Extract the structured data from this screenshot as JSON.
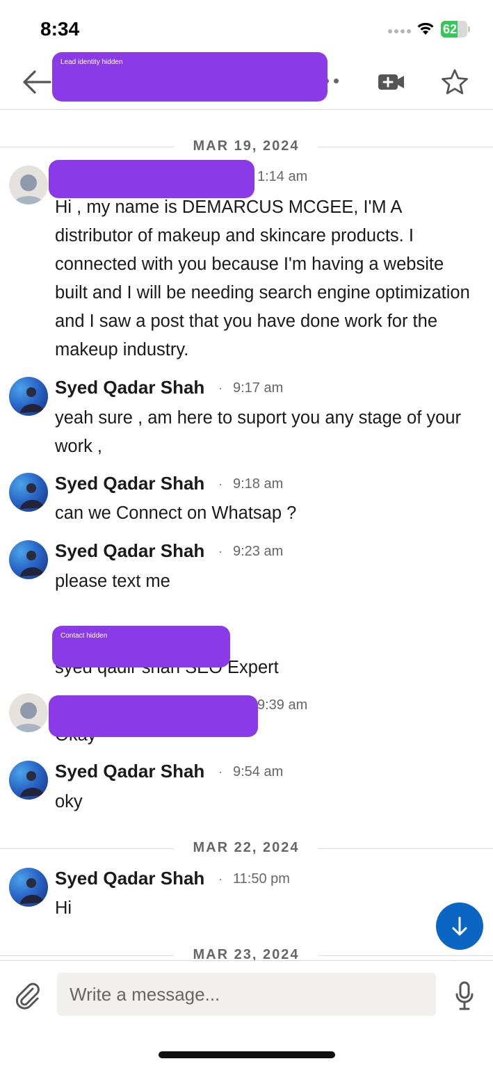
{
  "status_bar": {
    "time": "8:34",
    "battery": "62",
    "battery_level": 0.62
  },
  "header": {
    "redaction_label": "Lead identity hidden",
    "back_icon": "arrow-left-icon",
    "video_icon": "video-call-icon",
    "star_icon": "star-outline-icon"
  },
  "dates": [
    "MAR 19, 2024",
    "MAR 22, 2024",
    "MAR 23, 2024"
  ],
  "messages": [
    {
      "sender": "",
      "time": "1:14 am",
      "text": "Hi , my name is DEMARCUS MCGEE,  I'M A distributor of makeup and skincare products. I connected with you because I'm having a website built and I will be needing search engine optimization and I saw a post that you have done work for the makeup industry."
    },
    {
      "sender": "Syed Qadar Shah",
      "time": "9:17 am",
      "text": "yeah sure , am here to suport you any stage of your work ,"
    },
    {
      "sender": "Syed Qadar Shah",
      "time": "9:18 am",
      "text": "can we Connect on Whatsap ?"
    },
    {
      "sender": "Syed Qadar Shah",
      "time": "9:23 am",
      "text": "please text me",
      "contact_redaction_label": "Contact hidden",
      "signature": "syed qadir shah SEO Expert"
    },
    {
      "sender": "",
      "time": "9:39 am",
      "text": "Okay"
    },
    {
      "sender": "Syed Qadar Shah",
      "time": "9:54 am",
      "text": "oky"
    },
    {
      "sender": "Syed Qadar Shah",
      "time": "11:50 pm",
      "text": "Hi"
    }
  ],
  "separator": "·",
  "composer": {
    "placeholder": "Write a message...",
    "attach_icon": "paperclip-icon",
    "mic_icon": "microphone-icon"
  },
  "scroll_fab": {
    "icon": "arrow-down-icon",
    "color": "#0a66c2"
  },
  "colors": {
    "redaction": "#8a3ae6",
    "accent": "#0a66c2",
    "battery": "#34c759"
  }
}
